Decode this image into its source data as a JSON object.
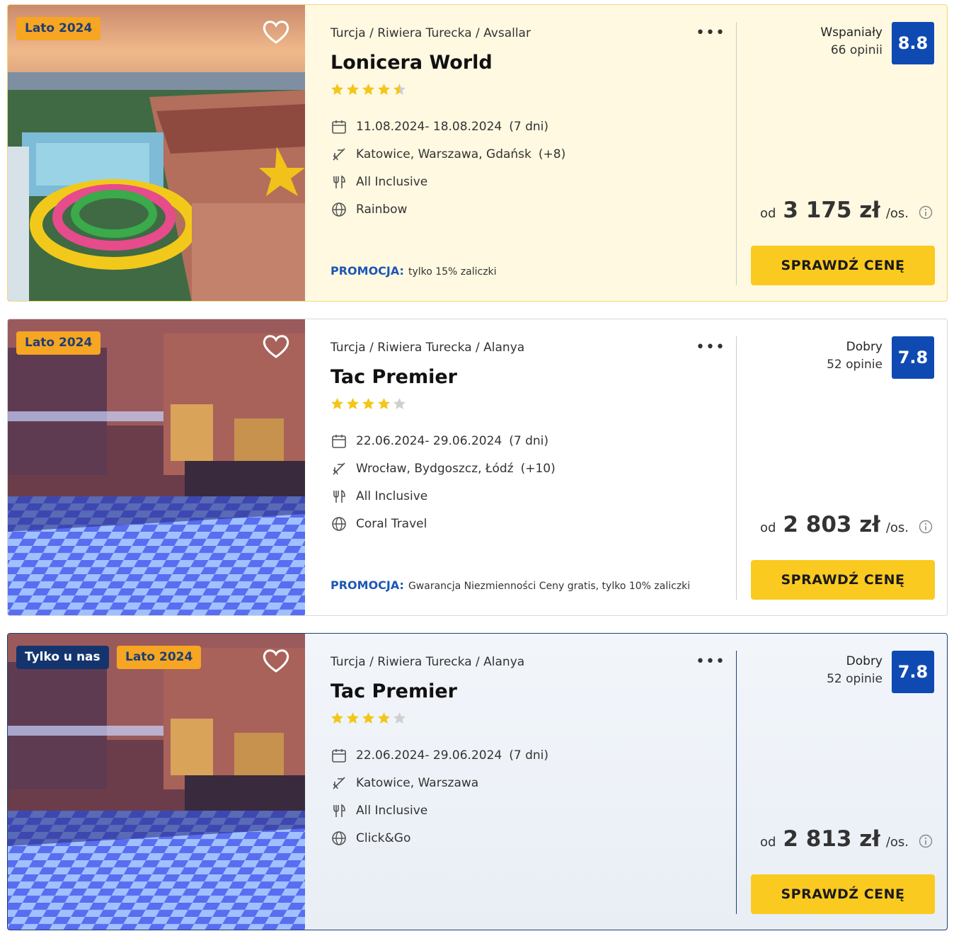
{
  "offers": [
    {
      "tags": [
        "Lato 2024"
      ],
      "breadcrumb": "Turcja / Riwiera Turecka / Avsallar",
      "hotel_name": "Lonicera World",
      "stars": 4.5,
      "dates": "11.08.2024- 18.08.2024",
      "duration": "(7 dni)",
      "departures": "Katowice, Warszawa, Gdańsk",
      "departures_more": "(+8)",
      "board": "All Inclusive",
      "operator": "Rainbow",
      "promo_label": "PROMOCJA:",
      "promo_text": "tylko 15% zaliczki",
      "rating_word": "Wspaniały",
      "rating_count": "66 opinii",
      "rating_score": "8.8",
      "price_prefix": "od",
      "price": "3 175 zł",
      "price_unit": "/os.",
      "cta": "SPRAWDŹ CENĘ"
    },
    {
      "tags": [
        "Lato 2024"
      ],
      "breadcrumb": "Turcja / Riwiera Turecka / Alanya",
      "hotel_name": "Tac Premier",
      "stars": 4,
      "dates": "22.06.2024- 29.06.2024",
      "duration": "(7 dni)",
      "departures": "Wrocław, Bydgoszcz, Łódź",
      "departures_more": "(+10)",
      "board": "All Inclusive",
      "operator": "Coral Travel",
      "promo_label": "PROMOCJA:",
      "promo_text": "Gwarancja Niezmienności Ceny gratis, tylko 10% zaliczki",
      "rating_word": "Dobry",
      "rating_count": "52 opinie",
      "rating_score": "7.8",
      "price_prefix": "od",
      "price": "2 803 zł",
      "price_unit": "/os.",
      "cta": "SPRAWDŹ CENĘ"
    },
    {
      "tags": [
        "Tylko u nas",
        "Lato 2024"
      ],
      "breadcrumb": "Turcja / Riwiera Turecka / Alanya",
      "hotel_name": "Tac Premier",
      "stars": 4,
      "dates": "22.06.2024- 29.06.2024",
      "duration": "(7 dni)",
      "departures": "Katowice, Warszawa",
      "departures_more": "",
      "board": "All Inclusive",
      "operator": "Click&Go",
      "promo_label": "",
      "promo_text": "",
      "rating_word": "Dobry",
      "rating_count": "52 opinie",
      "rating_score": "7.8",
      "price_prefix": "od",
      "price": "2 813 zł",
      "price_unit": "/os.",
      "cta": "SPRAWDŹ CENĘ"
    }
  ],
  "icons": {
    "more": "more-dots-icon",
    "favorite": "heart-icon",
    "dates": "calendar-icon",
    "departures": "plane-icon",
    "board": "cutlery-icon",
    "operator": "globe-icon",
    "info": "info-icon"
  },
  "colors": {
    "cta": "#fbca20",
    "score_badge": "#0f4ab3",
    "season_tag": "#f6a623",
    "exclusive_tag": "#14346e",
    "promo_label": "#1c57b3",
    "star": "#f5c518"
  }
}
